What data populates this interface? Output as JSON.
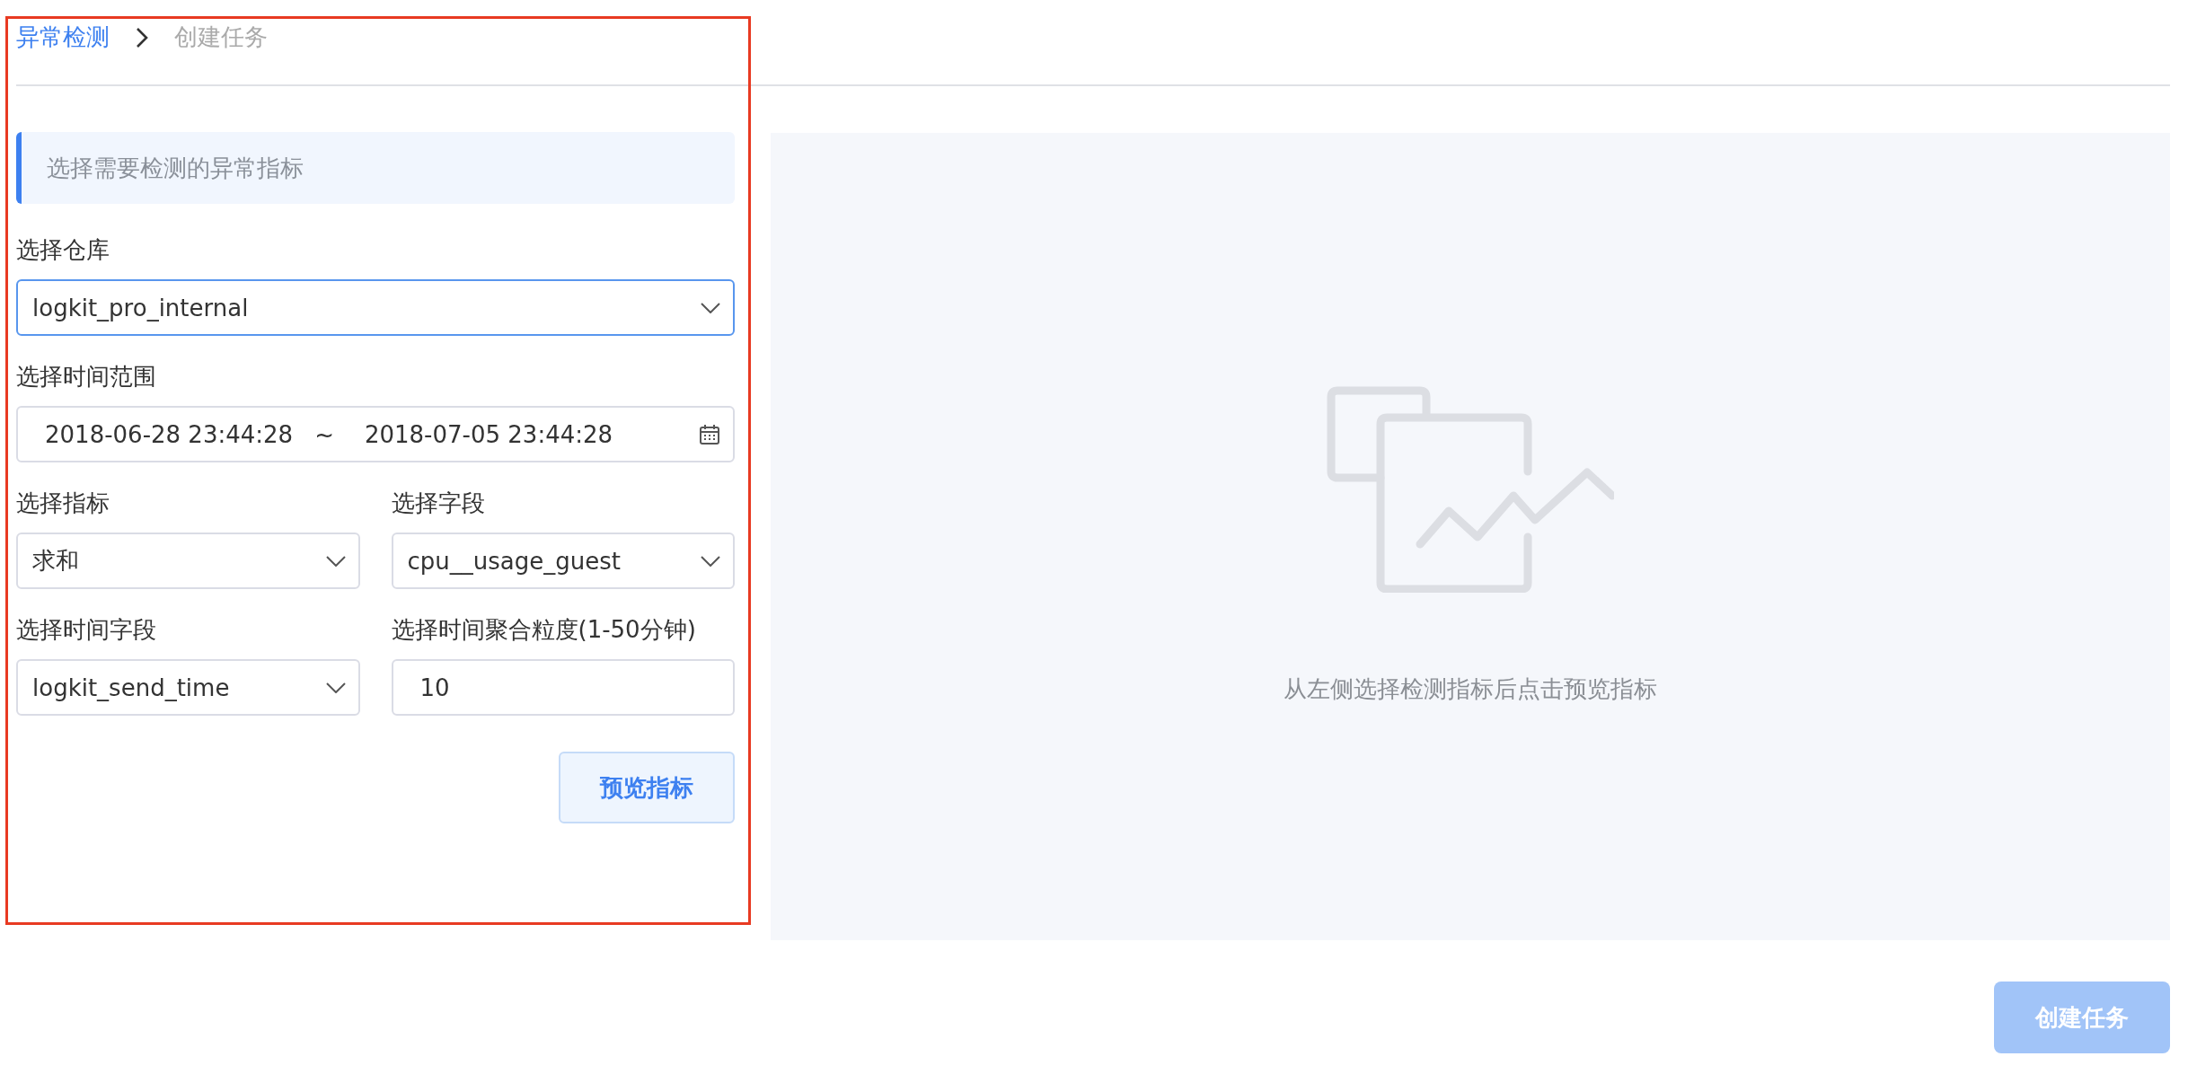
{
  "breadcrumb": [
    {
      "label": "异常检测",
      "current": false
    },
    {
      "label": "创建任务",
      "current": true
    }
  ],
  "section_title": "选择需要检测的异常指标",
  "form_rows": [
    {
      "fields": [
        {
          "kind": "select",
          "label": "选择仓库",
          "value": "logkit_pro_internal",
          "focused": true
        }
      ]
    },
    {
      "fields": [
        {
          "kind": "daterange",
          "label": "选择时间范围",
          "start": "2018-06-28 23:44:28",
          "separator": "~",
          "end": "2018-07-05 23:44:28",
          "focused": false
        }
      ]
    },
    {
      "fields": [
        {
          "kind": "select",
          "label": "选择指标",
          "value": "求和",
          "focused": false
        },
        {
          "kind": "select",
          "label": "选择字段",
          "value": "cpu__usage_guest",
          "focused": false
        }
      ]
    },
    {
      "fields": [
        {
          "kind": "select",
          "label": "选择时间字段",
          "value": "logkit_send_time",
          "focused": false
        },
        {
          "kind": "input",
          "label": "选择时间聚合粒度(1-50分钟)",
          "value": "10",
          "focused": false
        }
      ]
    }
  ],
  "preview_button": {
    "label": "预览指标"
  },
  "empty_state": {
    "text": "从左侧选择检测指标后点击预览指标"
  },
  "create_button": {
    "label": "创建任务",
    "disabled": true
  }
}
